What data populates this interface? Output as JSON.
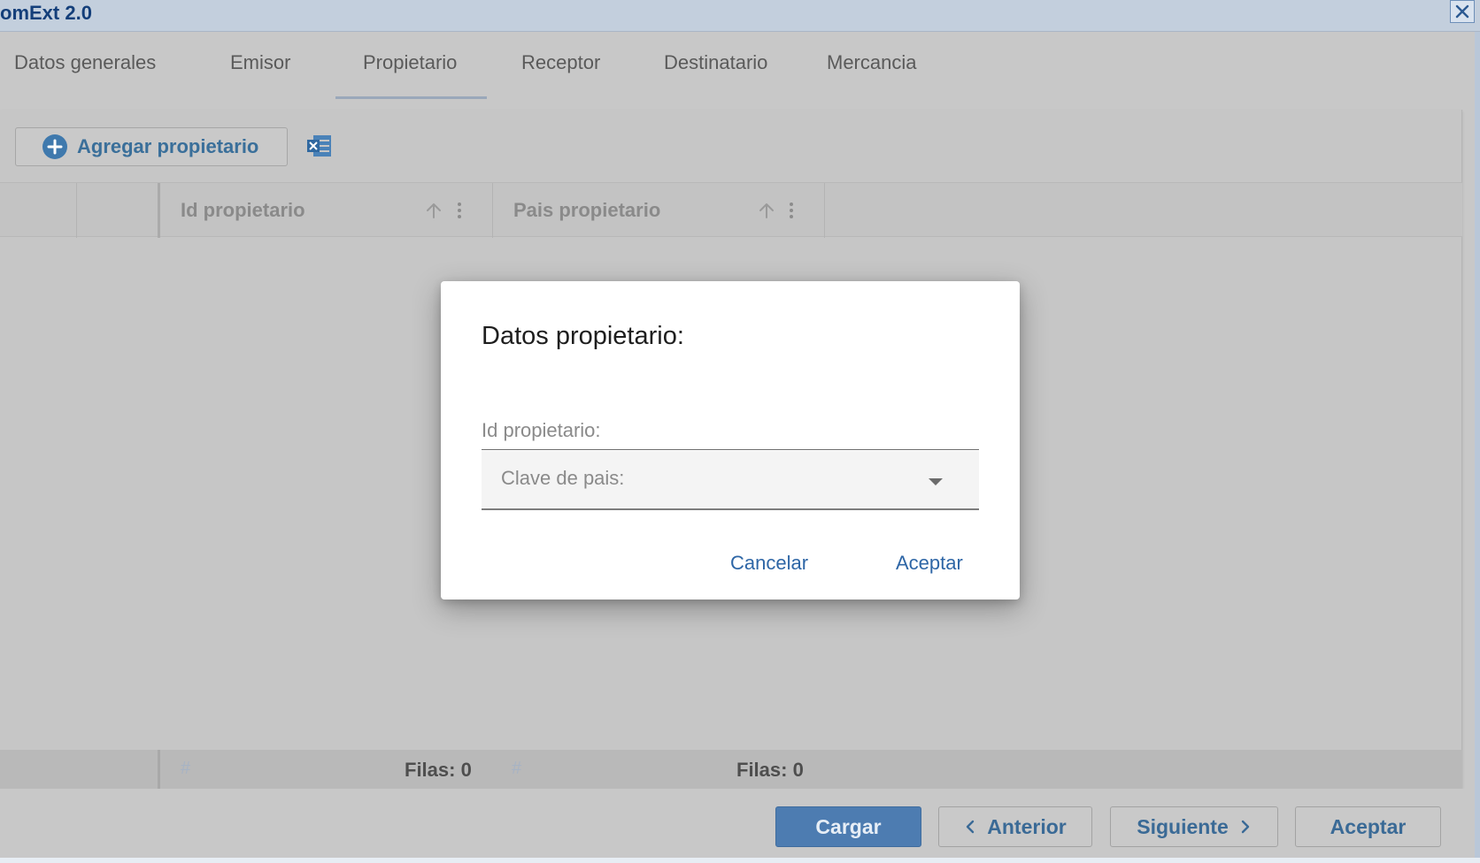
{
  "window": {
    "title": "omExt 2.0"
  },
  "tabs": [
    {
      "label": "Datos generales"
    },
    {
      "label": "Emisor"
    },
    {
      "label": "Propietario"
    },
    {
      "label": "Receptor"
    },
    {
      "label": "Destinatario"
    },
    {
      "label": "Mercancia"
    }
  ],
  "active_tab": "Propietario",
  "toolbar": {
    "add_label": "Agregar propietario",
    "excel_icon": "excel-export-icon"
  },
  "grid": {
    "columns": [
      {
        "label": "Id propietario"
      },
      {
        "label": "Pais propietario"
      }
    ],
    "footer": [
      {
        "hash": "#",
        "count": "Filas: 0"
      },
      {
        "hash": "#",
        "count": "Filas: 0"
      }
    ]
  },
  "buttons": {
    "cargar": "Cargar",
    "anterior": "Anterior",
    "siguiente": "Siguiente",
    "aceptar": "Aceptar"
  },
  "dialog": {
    "title": "Datos propietario:",
    "id_label": "Id propietario:",
    "select_label": "Clave de pais:",
    "cancel": "Cancelar",
    "accept": "Aceptar"
  },
  "colors": {
    "accent": "#4d7cb1",
    "link": "#2e66a6",
    "title_text": "#143f7a"
  }
}
